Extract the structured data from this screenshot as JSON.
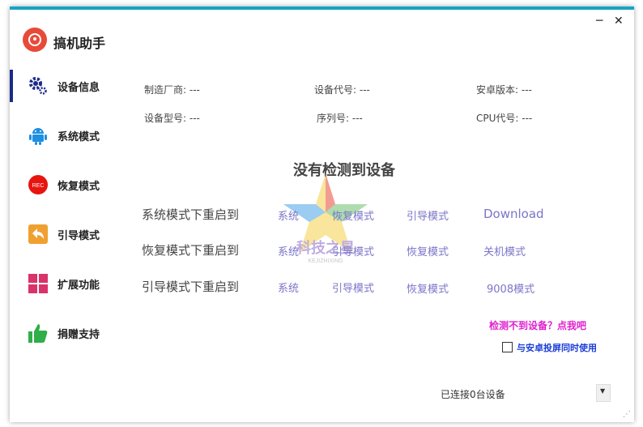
{
  "window": {
    "minimize": "─",
    "close": "✕"
  },
  "app": {
    "title": "搞机助手"
  },
  "sidebar": {
    "items": [
      {
        "label": "设备信息",
        "icon": "gears-icon"
      },
      {
        "label": "系统模式",
        "icon": "android-icon"
      },
      {
        "label": "恢复模式",
        "icon": "rec-icon",
        "badge": "REC"
      },
      {
        "label": "引导模式",
        "icon": "back-arrow-icon"
      },
      {
        "label": "扩展功能",
        "icon": "grid-icon"
      },
      {
        "label": "捐赠支持",
        "icon": "thumbs-up-icon"
      }
    ]
  },
  "device_info": {
    "manufacturer": "制造厂商: ---",
    "device_code": "设备代号: ---",
    "android_version": "安卓版本: ---",
    "model": "设备型号: ---",
    "serial": "序列号: ---",
    "cpu": "CPU代号: ---"
  },
  "no_device": "没有检测到设备",
  "reboot": {
    "rows": [
      {
        "label": "系统模式下重启到",
        "options": [
          "系统",
          "恢复模式",
          "引导模式",
          "Download"
        ]
      },
      {
        "label": "恢复模式下重启到",
        "options": [
          "系统",
          "引导模式",
          "恢复模式",
          "关机模式"
        ]
      },
      {
        "label": "引导模式下重启到",
        "options": [
          "系统",
          "引导模式",
          "恢复模式",
          "9008模式"
        ]
      }
    ]
  },
  "help_link": "检测不到设备？点我吧",
  "screen_cast_checkbox": {
    "label": "与安卓投屏同时使用",
    "checked": false
  },
  "status": {
    "connected": "已连接0台设备",
    "dropdown_arrow": "▼"
  },
  "watermark": {
    "text": "科技之星",
    "subtext": "KEJIZHIXING"
  },
  "colors": {
    "accent": "#1aa3c4",
    "link": "#7a75c8",
    "help": "#e01fd0",
    "checkbox_label": "#1a3cd6"
  }
}
